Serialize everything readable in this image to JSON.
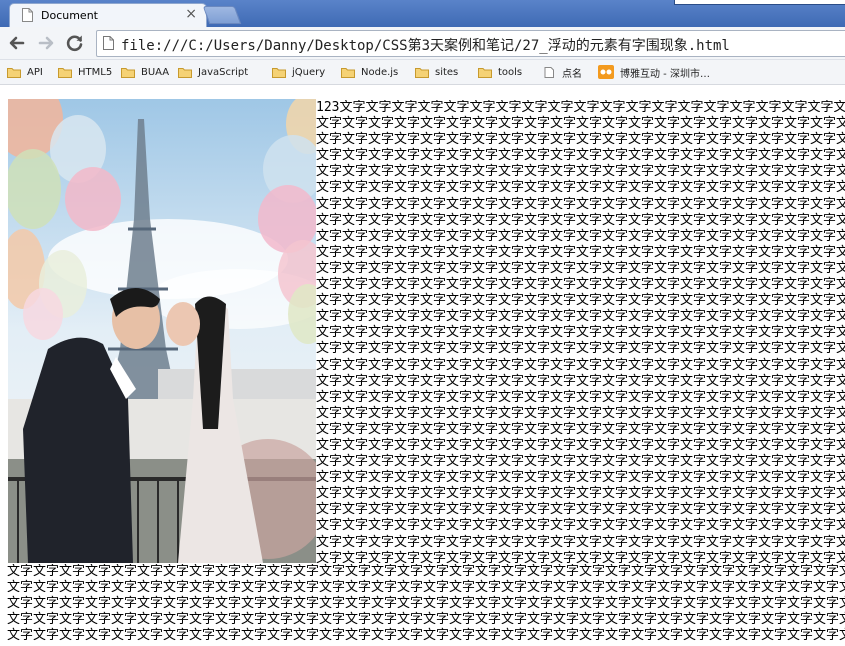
{
  "tab": {
    "title": "Document",
    "close": "×"
  },
  "address_bar": {
    "url": "file:///C:/Users/Danny/Desktop/CSS第3天案例和笔记/27_浮动的元素有字围现象.html"
  },
  "bookmarks": [
    {
      "label": "API",
      "icon": "folder-icon"
    },
    {
      "label": "HTML5",
      "icon": "folder-icon"
    },
    {
      "label": "BUAA",
      "icon": "folder-icon"
    },
    {
      "label": "JavaScript",
      "icon": "folder-icon"
    },
    {
      "label": "jQuery",
      "icon": "folder-icon"
    },
    {
      "label": "Node.js",
      "icon": "folder-icon"
    },
    {
      "label": "sites",
      "icon": "folder-icon"
    },
    {
      "label": "tools",
      "icon": "folder-icon"
    },
    {
      "label": "点名",
      "icon": "page-icon"
    },
    {
      "label": "博雅互动 - 深圳市…",
      "icon": "boyaa-icon"
    }
  ],
  "content": {
    "lead_text": "123",
    "filler_text": "文字",
    "colors": {
      "tab_strip": "#4a76c0",
      "boyaa_icon": "#f39a1e"
    }
  }
}
